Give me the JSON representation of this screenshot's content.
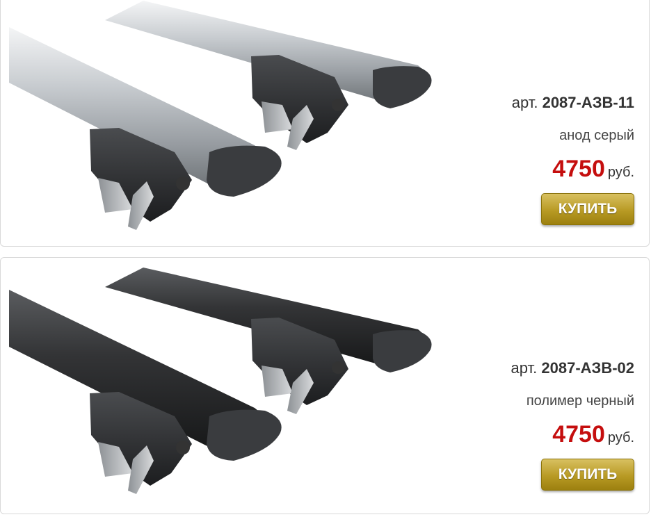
{
  "products": [
    {
      "art_prefix": "арт.",
      "art_number": "2087-АЗВ-11",
      "finish": "анод серый",
      "price": "4750",
      "currency": "руб.",
      "buy_label": "КУПИТЬ",
      "bar_color": "#b9bec3"
    },
    {
      "art_prefix": "арт.",
      "art_number": "2087-АЗВ-02",
      "finish": "полимер черный",
      "price": "4750",
      "currency": "руб.",
      "buy_label": "КУПИТЬ",
      "bar_color": "#2c2d2f"
    }
  ],
  "colors": {
    "price": "#c50e0e",
    "button": "#b89a24"
  }
}
